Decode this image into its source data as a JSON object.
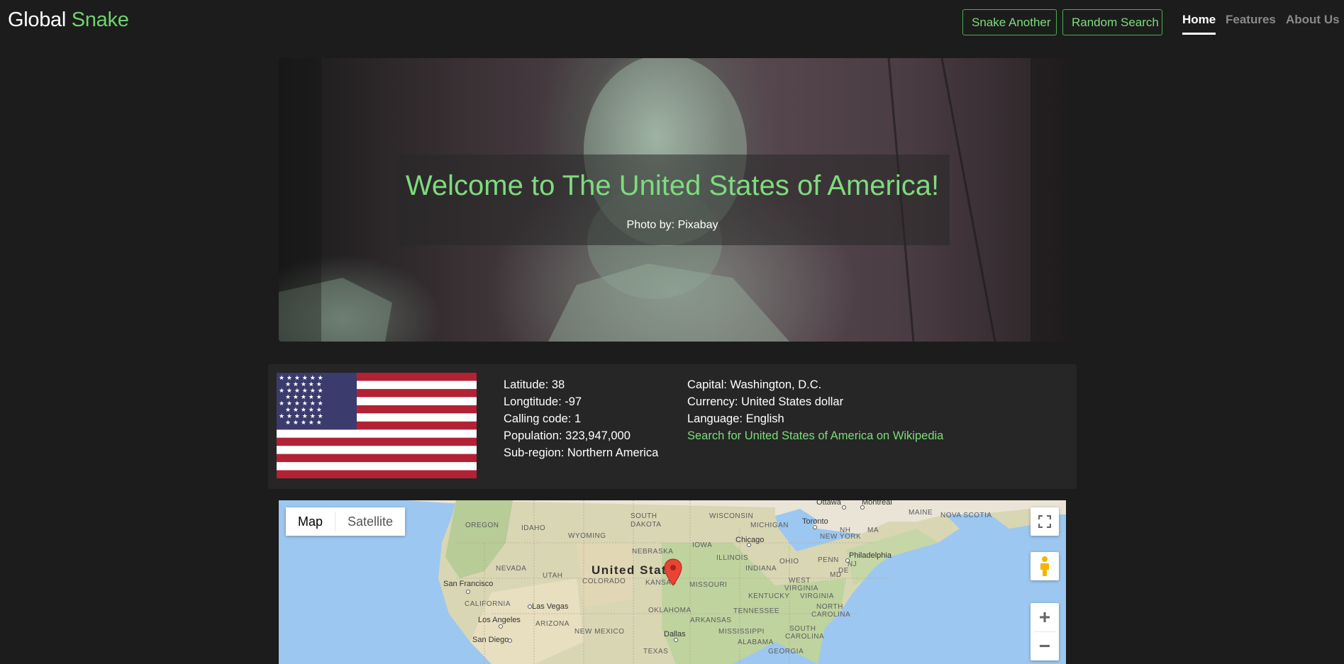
{
  "navbar": {
    "brand_part1": "Global",
    "brand_part2": "Snake",
    "buttons": {
      "snake_another": "Snake Another",
      "random_search": "Random Search"
    },
    "links": {
      "home": "Home",
      "features": "Features",
      "about": "About Us"
    }
  },
  "hero": {
    "title": "Welcome to The United States of America!",
    "credit": "Photo by: Pixabay"
  },
  "country": {
    "latitude": "Latitude: 38",
    "longitude": "Longtitude: -97",
    "calling_code": "Calling code: 1",
    "population": "Population: 323,947,000",
    "sub_region": "Sub-region: Northern America",
    "capital": "Capital: Washington, D.C.",
    "currency": "Currency: United States dollar",
    "language": "Language: English",
    "wiki_link": "Search for United States of America on Wikipedia",
    "flag_colors": {
      "red": "#b22234",
      "white": "#ffffff",
      "blue": "#3c3b6e"
    }
  },
  "map": {
    "map_type_map": "Map",
    "map_type_satellite": "Satellite",
    "zoom_in": "+",
    "zoom_out": "−",
    "country_label": "United States",
    "state_labels": {
      "oregon": "OREGON",
      "idaho": "IDAHO",
      "wyoming": "WYOMING",
      "south_dakota_1": "SOUTH",
      "south_dakota_2": "DAKOTA",
      "nebraska": "NEBRASKA",
      "iowa": "IOWA",
      "wisconsin": "WISCONSIN",
      "michigan": "MICHIGAN",
      "illinois": "ILLINOIS",
      "indiana": "INDIANA",
      "ohio": "OHIO",
      "penn": "PENN",
      "new_york": "NEW YORK",
      "nevada": "NEVADA",
      "utah": "UTAH",
      "colorado": "COLORADO",
      "kansas": "KANSAS",
      "missouri": "MISSOURI",
      "kentucky": "KENTUCKY",
      "west_virginia_1": "WEST",
      "west_virginia_2": "VIRGINIA",
      "virginia": "VIRGINIA",
      "california": "CALIFORNIA",
      "arizona": "ARIZONA",
      "new_mexico": "NEW MEXICO",
      "oklahoma": "OKLAHOMA",
      "arkansas": "ARKANSAS",
      "tennessee": "TENNESSEE",
      "north_carolina_1": "NORTH",
      "north_carolina_2": "CAROLINA",
      "south_carolina_1": "SOUTH",
      "south_carolina_2": "CAROLINA",
      "mississippi": "MISSISSIPPI",
      "alabama": "ALABAMA",
      "georgia": "GEORGIA",
      "texas": "TEXAS",
      "maine": "MAINE",
      "nova_scotia": "NOVA SCOTIA",
      "md": "MD",
      "de": "DE",
      "nj": "NJ",
      "ma": "MA",
      "nh": "NH"
    },
    "city_labels": {
      "ottawa": "Ottawa",
      "montreal": "Montreal",
      "toronto": "Toronto",
      "chicago": "Chicago",
      "philadelphia": "Philadelphia",
      "san_francisco": "San Francisco",
      "las_vegas": "Las Vegas",
      "los_angeles": "Los Angeles",
      "san_diego": "San Diego",
      "dallas": "Dallas"
    }
  }
}
